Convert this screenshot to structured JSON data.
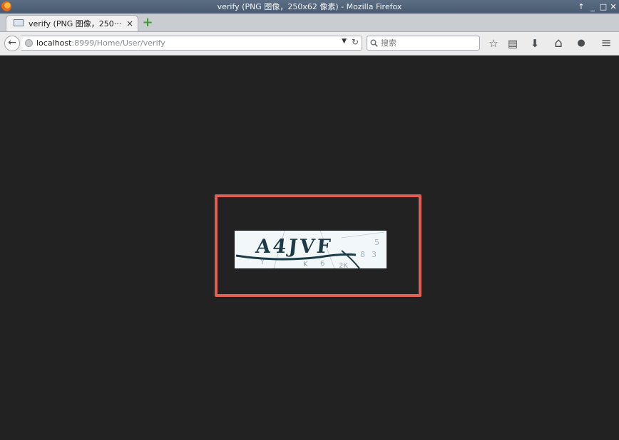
{
  "window": {
    "title": "verify (PNG 图像，250x62 像素) - Mozilla Firefox",
    "controls": [
      "↑",
      "_",
      "□",
      "✕"
    ]
  },
  "tab": {
    "title": "verify (PNG 图像，250···",
    "close": "×"
  },
  "newtab": {
    "label": "+"
  },
  "nav": {
    "back": "←",
    "url_host": "localhost",
    "url_path": ":8999/Home/User/verify",
    "dropdown": "▼",
    "reload": "↻"
  },
  "search": {
    "glass": "🔍",
    "placeholder": "搜索"
  },
  "toolbar": {
    "bookmark": "☆",
    "reader": "▤",
    "download": "⬇",
    "home": "⌂",
    "chat": "●",
    "menu": "≡"
  },
  "captcha": {
    "text": "A4JVF",
    "noise": [
      "5",
      "8",
      "3",
      "Y",
      "K",
      "6",
      "2K"
    ],
    "colors": {
      "text": "#1c3b46",
      "background": "#f2f7f9",
      "highlight": "#e25f56"
    }
  }
}
